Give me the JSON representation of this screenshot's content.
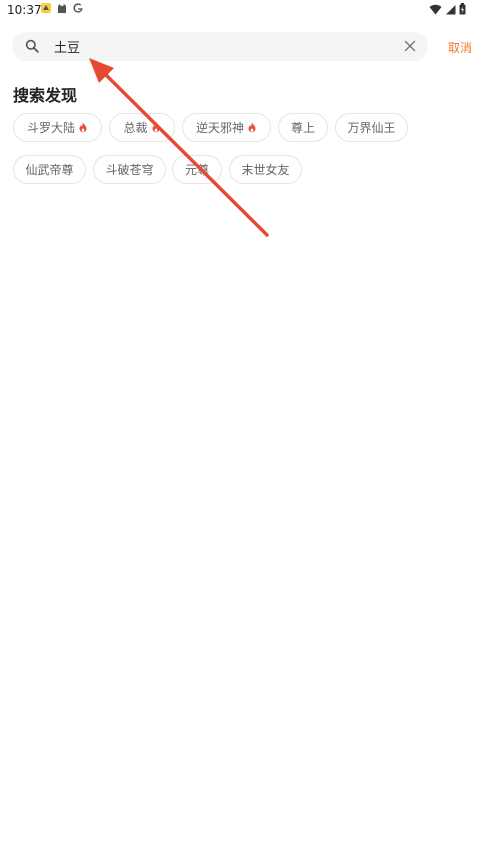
{
  "status_bar": {
    "time": "10:37"
  },
  "search": {
    "value": "土豆",
    "cancel_label": "取消"
  },
  "discover": {
    "title": "搜索发现",
    "tags": [
      {
        "label": "斗罗大陆",
        "hot": true
      },
      {
        "label": "总裁",
        "hot": true
      },
      {
        "label": "逆天邪神",
        "hot": true
      },
      {
        "label": "尊上",
        "hot": false
      },
      {
        "label": "万界仙王",
        "hot": false
      },
      {
        "label": "仙武帝尊",
        "hot": false
      },
      {
        "label": "斗破苍穹",
        "hot": false
      },
      {
        "label": "元尊",
        "hot": false
      },
      {
        "label": "末世女友",
        "hot": false
      }
    ]
  },
  "colors": {
    "accent": "#f07b2e",
    "hot": "#e74c3c",
    "arrow": "#e64a35"
  }
}
